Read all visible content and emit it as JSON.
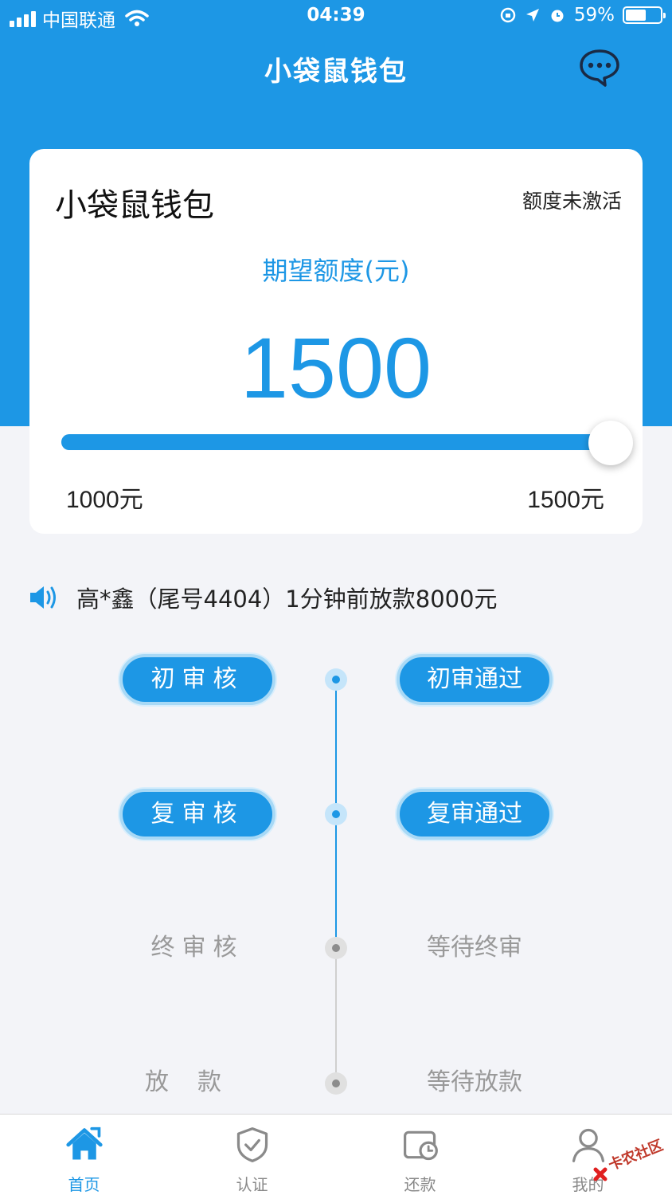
{
  "status_bar": {
    "carrier": "中国联通",
    "time": "04:39",
    "battery": "59%",
    "battery_level": 0.59
  },
  "header": {
    "title": "小袋鼠钱包"
  },
  "card": {
    "title": "小袋鼠钱包",
    "status": "额度未激活",
    "amount_label": "期望额度(元)",
    "amount": "1500",
    "min_label": "1000元",
    "max_label": "1500元",
    "slider_fraction": 1.0
  },
  "notice": {
    "text": "高*鑫（尾号4404）1分钟前放款8000元"
  },
  "timeline": {
    "steps": [
      {
        "label": "初审核",
        "status": "初审通过",
        "state": "done"
      },
      {
        "label": "复审核",
        "status": "复审通过",
        "state": "done"
      },
      {
        "label": "终审核",
        "status": "等待终审",
        "state": "pending"
      },
      {
        "label": "放款",
        "status": "等待放款",
        "state": "pending"
      }
    ]
  },
  "tabs": [
    {
      "label": "首页",
      "icon": "home-icon",
      "active": true
    },
    {
      "label": "认证",
      "icon": "shield-check-icon",
      "active": false
    },
    {
      "label": "还款",
      "icon": "repay-clock-icon",
      "active": false
    },
    {
      "label": "我的",
      "icon": "user-icon",
      "active": false
    }
  ],
  "watermark": {
    "text": "卡农社区"
  },
  "colors": {
    "primary": "#1d97e5",
    "background": "#f3f4f8"
  }
}
